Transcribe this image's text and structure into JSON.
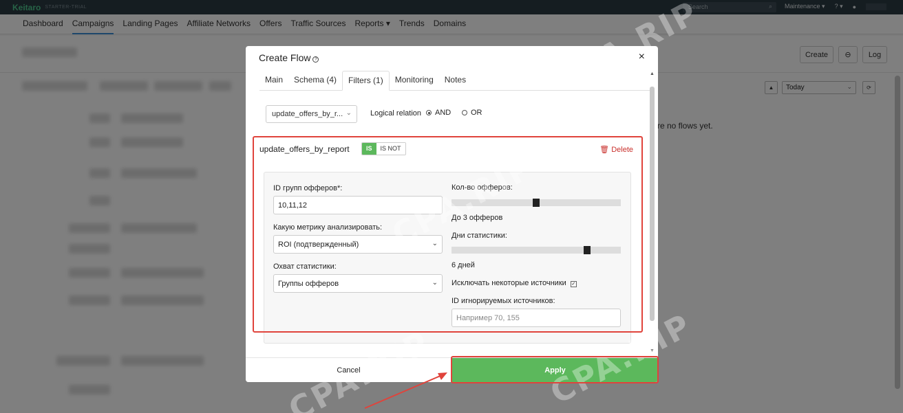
{
  "topbar": {
    "brand": "Keitaro",
    "brand_sub": "STARTER-TRIAL",
    "search_placeholder": "Search",
    "maintenance": "Maintenance ▾",
    "help": "? ▾"
  },
  "nav": [
    "Dashboard",
    "Campaigns",
    "Landing Pages",
    "Affiliate Networks",
    "Offers",
    "Traffic Sources",
    "Reports ▾",
    "Trends",
    "Domains"
  ],
  "background": {
    "create_label": "Create",
    "link_label": "⊖",
    "log_label": "Log",
    "date_select": "Today",
    "empty_text": "re no flows yet."
  },
  "modal": {
    "title": "Create Flow",
    "close": "×",
    "tabs": [
      "Main",
      "Schema (4)",
      "Filters (1)",
      "Monitoring",
      "Notes"
    ],
    "filter_select": "update_offers_by_r...",
    "logic_label": "Logical relation",
    "logic_and": "AND",
    "logic_or": "OR",
    "filter": {
      "name": "update_offers_by_report",
      "is_label": "IS",
      "is_not_label": "IS NOT",
      "delete_label": "Delete",
      "offer_groups_label": "ID групп офферов*:",
      "offer_groups_value": "10,11,12",
      "metric_label": "Какую метрику анализировать:",
      "metric_value": "ROI (подтвержденный)",
      "coverage_label": "Охват статистики:",
      "coverage_value": "Группы офферов",
      "offers_count_label": "Кол-во офферов:",
      "offers_count_text": "До 3 офферов",
      "offers_count_level": 0.5,
      "stat_days_label": "Дни статистики:",
      "stat_days_text": "6 дней",
      "stat_days_level": 0.8,
      "exclude_label": "Исключать некоторые источники",
      "exclude_checked": true,
      "ignored_ids_label": "ID игнорируемых источников:",
      "ignored_ids_placeholder": "Например 70, 155"
    },
    "cancel_label": "Cancel",
    "apply_label": "Apply"
  },
  "watermark": "CPA.RIP",
  "colors": {
    "accent": "#3b8ed6",
    "success": "#5cb85c",
    "danger": "#c9302c",
    "annotation": "#e0433b",
    "topbar": "#2b3a42"
  }
}
